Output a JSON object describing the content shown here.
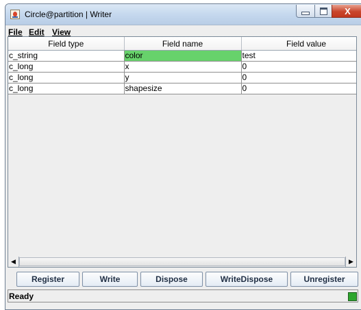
{
  "window": {
    "title": "Circle@partition | Writer",
    "controls": {
      "minimize": "–",
      "maximize": "□",
      "close": "X"
    }
  },
  "menu": [
    {
      "label": "File",
      "mnemonic": "F"
    },
    {
      "label": "Edit",
      "mnemonic": "E"
    },
    {
      "label": "View",
      "mnemonic": "V"
    }
  ],
  "table": {
    "columns": [
      "Field type",
      "Field name",
      "Field value"
    ],
    "rows": [
      {
        "type": "c_string",
        "name": "color",
        "value": "test",
        "selected": true
      },
      {
        "type": "c_long",
        "name": "x",
        "value": "0"
      },
      {
        "type": "c_long",
        "name": "y",
        "value": "0"
      },
      {
        "type": "c_long",
        "name": "shapesize",
        "value": "0"
      }
    ],
    "selected_color": "#67d26b"
  },
  "scrollbar": {
    "left_arrow": "◀",
    "right_arrow": "▶"
  },
  "buttons": {
    "register": "Register",
    "write": "Write",
    "dispose": "Dispose",
    "write_dispose": "WriteDispose",
    "unregister": "Unregister"
  },
  "status": {
    "text": "Ready",
    "indicator_color": "#2ea62e"
  }
}
